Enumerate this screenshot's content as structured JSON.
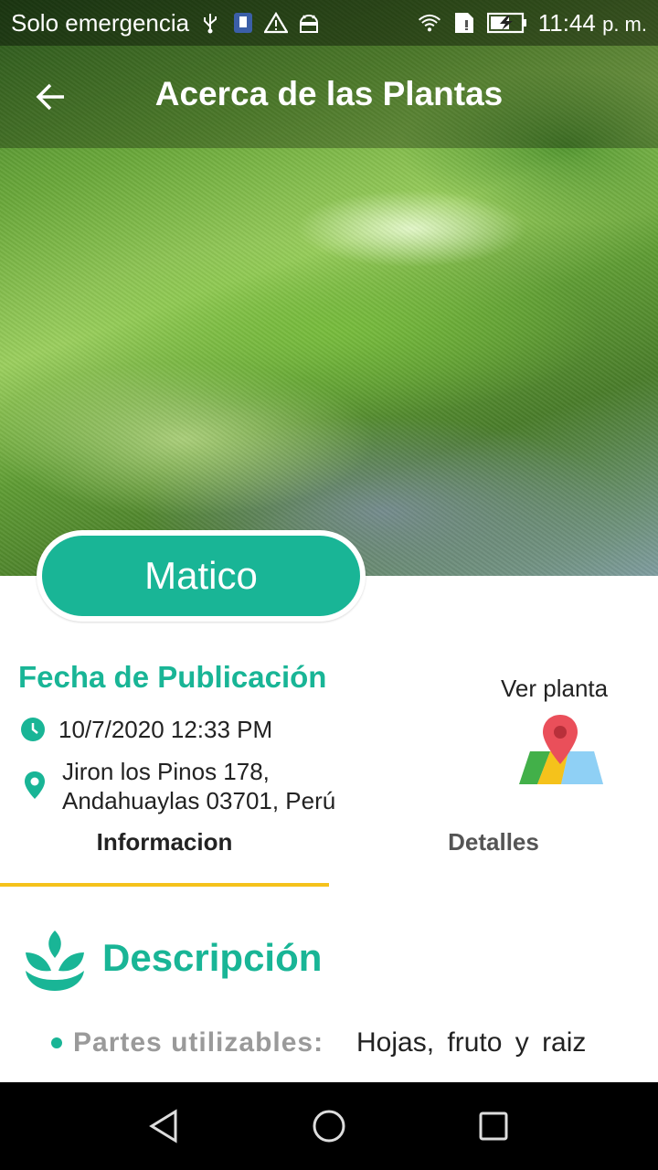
{
  "status_bar": {
    "carrier": "Solo emergencia",
    "time": "11:44",
    "ampm": "p. m.",
    "icons": [
      "usb-icon",
      "screenshot-icon",
      "warning-icon",
      "android-icon",
      "wifi-icon",
      "sim-icon",
      "battery-charging-icon"
    ]
  },
  "app_bar": {
    "title": "Acerca de las Plantas",
    "back_icon": "arrow-back-icon"
  },
  "plant": {
    "name": "Matico"
  },
  "publication": {
    "title": "Fecha de Publicación",
    "date": "10/7/2020 12:33 PM",
    "address_line1": "Jiron los Pinos 178,",
    "address_line2": "Andahuaylas 03701, Perú"
  },
  "map_action": {
    "label": "Ver planta",
    "icon": "maps-icon"
  },
  "tabs": [
    {
      "label": "Informacion",
      "selected": true
    },
    {
      "label": "Detalles",
      "selected": false
    }
  ],
  "description": {
    "title": "Descripción",
    "icon": "sprout-icon",
    "parts_label": "Partes utilizables:",
    "parts_value": "Hojas, fruto y raiz"
  },
  "colors": {
    "accent": "#19b596",
    "tab_indicator": "#f5c21b",
    "map_pin": "#ea4f5a"
  }
}
